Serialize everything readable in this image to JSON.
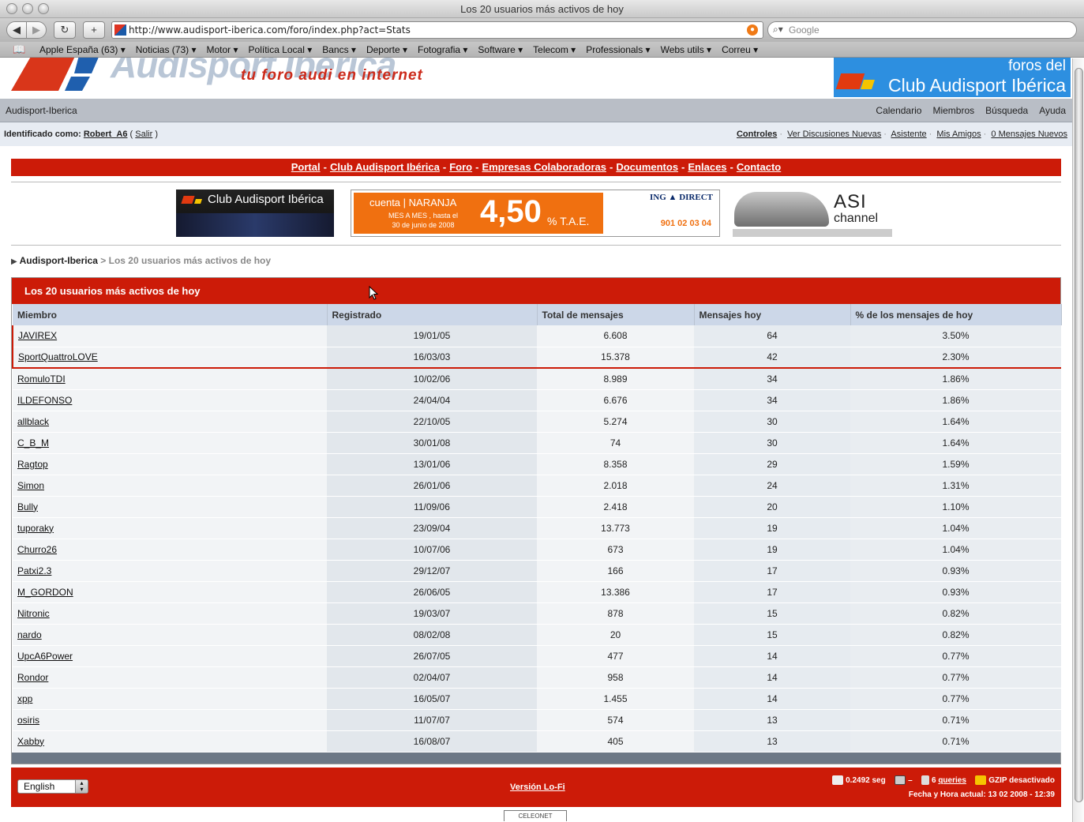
{
  "window": {
    "title": "Los 20 usuarios más activos de hoy"
  },
  "toolbar": {
    "url": "http://www.audisport-iberica.com/foro/index.php?act=Stats",
    "search_placeholder": "Google"
  },
  "bookmarks": [
    "Apple España (63) ▾",
    "Noticias (73) ▾",
    "Motor ▾",
    "Política Local ▾",
    "Bancs ▾",
    "Deporte ▾",
    "Fotografia ▾",
    "Software ▾",
    "Telecom ▾",
    "Professionals ▾",
    "Webs utils ▾",
    "Correu ▾"
  ],
  "banner": {
    "logo_text": "Audisport Ibérica",
    "slogan": "tu foro audi en internet",
    "club_top": "foros del",
    "club_name": "Club Audisport Ibérica"
  },
  "navbar": {
    "site": "Audisport-Iberica",
    "links": [
      "Calendario",
      "Miembros",
      "Búsqueda",
      "Ayuda"
    ]
  },
  "identity": {
    "label": "Identificado como:",
    "user": "Robert_A6",
    "logout": "Salir",
    "controls": [
      "Controles",
      "Ver Discusiones Nuevas",
      "Asistente",
      "Mis Amigos",
      "0 Mensajes Nuevos"
    ]
  },
  "redmenu": [
    "Portal",
    "Club Audisport Ibérica",
    "Foro",
    "Empresas Colaboradoras",
    "Documentos",
    "Enlaces",
    "Contacto"
  ],
  "ads": {
    "club": "Club Audisport Ibérica",
    "ing_account": "cuenta | NARANJA",
    "ing_sub": "MES A MES , hasta el 30 de junio de 2008",
    "ing_rate": "4,50",
    "ing_tae": "% T.A.E.",
    "ing_brand": "ING ▲ DIRECT",
    "ing_phone": "901 02 03 04",
    "asi": "ASI",
    "asi_channel": "channel"
  },
  "breadcrumb": {
    "home": "Audisport-Iberica",
    "current": "> Los 20 usuarios más activos de hoy"
  },
  "table": {
    "title": "Los 20 usuarios más activos de hoy",
    "columns": [
      "Miembro",
      "Registrado",
      "Total de mensajes",
      "Mensajes hoy",
      "% de los mensajes de hoy"
    ],
    "rows": [
      [
        "JAVIREX",
        "19/01/05",
        "6.608",
        "64",
        "3.50%"
      ],
      [
        "SportQuattroLOVE",
        "16/03/03",
        "15.378",
        "42",
        "2.30%"
      ],
      [
        "RomuloTDI",
        "10/02/06",
        "8.989",
        "34",
        "1.86%"
      ],
      [
        "ILDEFONSO",
        "24/04/04",
        "6.676",
        "34",
        "1.86%"
      ],
      [
        "allblack",
        "22/10/05",
        "5.274",
        "30",
        "1.64%"
      ],
      [
        "C_B_M",
        "30/01/08",
        "74",
        "30",
        "1.64%"
      ],
      [
        "Ragtop",
        "13/01/06",
        "8.358",
        "29",
        "1.59%"
      ],
      [
        "Simon",
        "26/01/06",
        "2.018",
        "24",
        "1.31%"
      ],
      [
        "Bully",
        "11/09/06",
        "2.418",
        "20",
        "1.10%"
      ],
      [
        "tuporaky",
        "23/09/04",
        "13.773",
        "19",
        "1.04%"
      ],
      [
        "Churro26",
        "10/07/06",
        "673",
        "19",
        "1.04%"
      ],
      [
        "Patxi2.3",
        "29/12/07",
        "166",
        "17",
        "0.93%"
      ],
      [
        "M_GORDON",
        "26/06/05",
        "13.386",
        "17",
        "0.93%"
      ],
      [
        "Nitronic",
        "19/03/07",
        "878",
        "15",
        "0.82%"
      ],
      [
        "nardo",
        "08/02/08",
        "20",
        "15",
        "0.82%"
      ],
      [
        "UpcA6Power",
        "26/07/05",
        "477",
        "14",
        "0.77%"
      ],
      [
        "Rondor",
        "02/04/07",
        "958",
        "14",
        "0.77%"
      ],
      [
        "xpp",
        "16/05/07",
        "1.455",
        "14",
        "0.77%"
      ],
      [
        "osiris",
        "11/07/07",
        "574",
        "13",
        "0.71%"
      ],
      [
        "Xabby",
        "16/08/07",
        "405",
        "13",
        "0.71%"
      ]
    ]
  },
  "footer": {
    "language": "English",
    "lofi": "Versión Lo-Fi",
    "time": "0.2492 seg",
    "dash": "–",
    "queries_n": "6",
    "queries": "queries",
    "gzip": "GZIP desactivado",
    "date": "Fecha y Hora actual: 13 02 2008 - 12:39",
    "celeonet": "CELEONET"
  }
}
